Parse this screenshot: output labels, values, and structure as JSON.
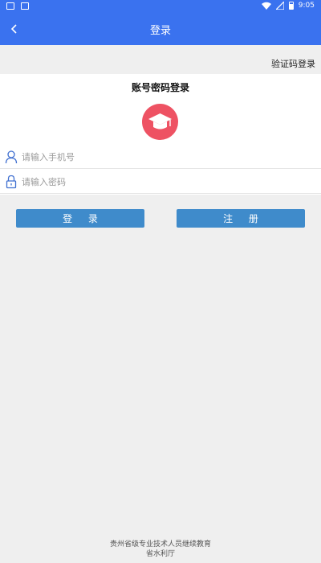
{
  "status_bar": {
    "time": "9:05"
  },
  "header": {
    "title": "登录"
  },
  "sms_login_link": "验证码登录",
  "heading": "账号密码登录",
  "phone": {
    "placeholder": "请输入手机号",
    "value": ""
  },
  "password": {
    "placeholder": "请输入密码",
    "value": ""
  },
  "buttons": {
    "login": "登 录",
    "register": "注 册"
  },
  "footer": {
    "line1": "贵州省级专业技术人员继续教育",
    "line2": "省水利厅"
  },
  "colors": {
    "primary": "#3a72ef",
    "button": "#3f8bcb",
    "logo_bg": "#ee5263"
  }
}
